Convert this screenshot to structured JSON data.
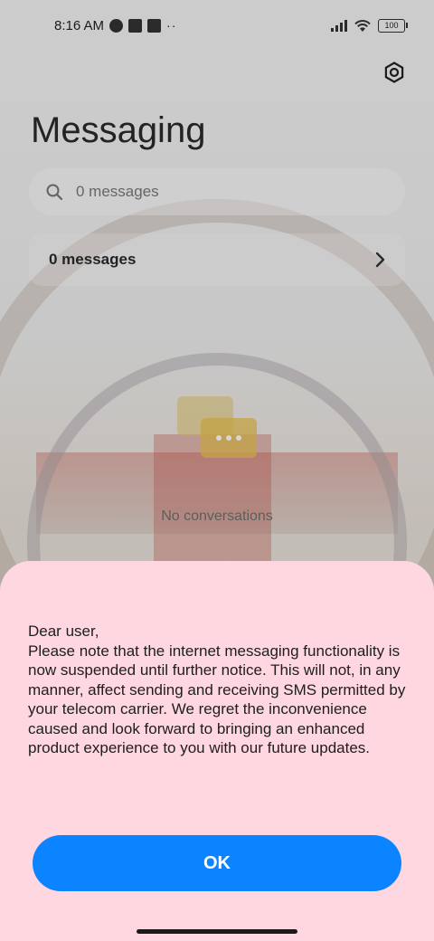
{
  "status_bar": {
    "time": "8:16 AM",
    "battery": "100",
    "overflow": "··"
  },
  "header": {
    "title": "Messaging",
    "settings_icon": "settings-gear-icon"
  },
  "search": {
    "placeholder": "0 messages"
  },
  "summary": {
    "label": "0 messages"
  },
  "empty_state": {
    "text": "No conversations"
  },
  "dialog": {
    "message": "Dear user,\nPlease note that the internet messaging functionality is now suspended until further notice. This will not, in any manner, affect sending and receiving SMS permitted by your telecom carrier. We regret the inconvenience caused and look forward to bringing an enhanced product experience to you with our future updates.",
    "ok_label": "OK",
    "background": "#fed7e1",
    "button_color": "#0c84ff"
  }
}
